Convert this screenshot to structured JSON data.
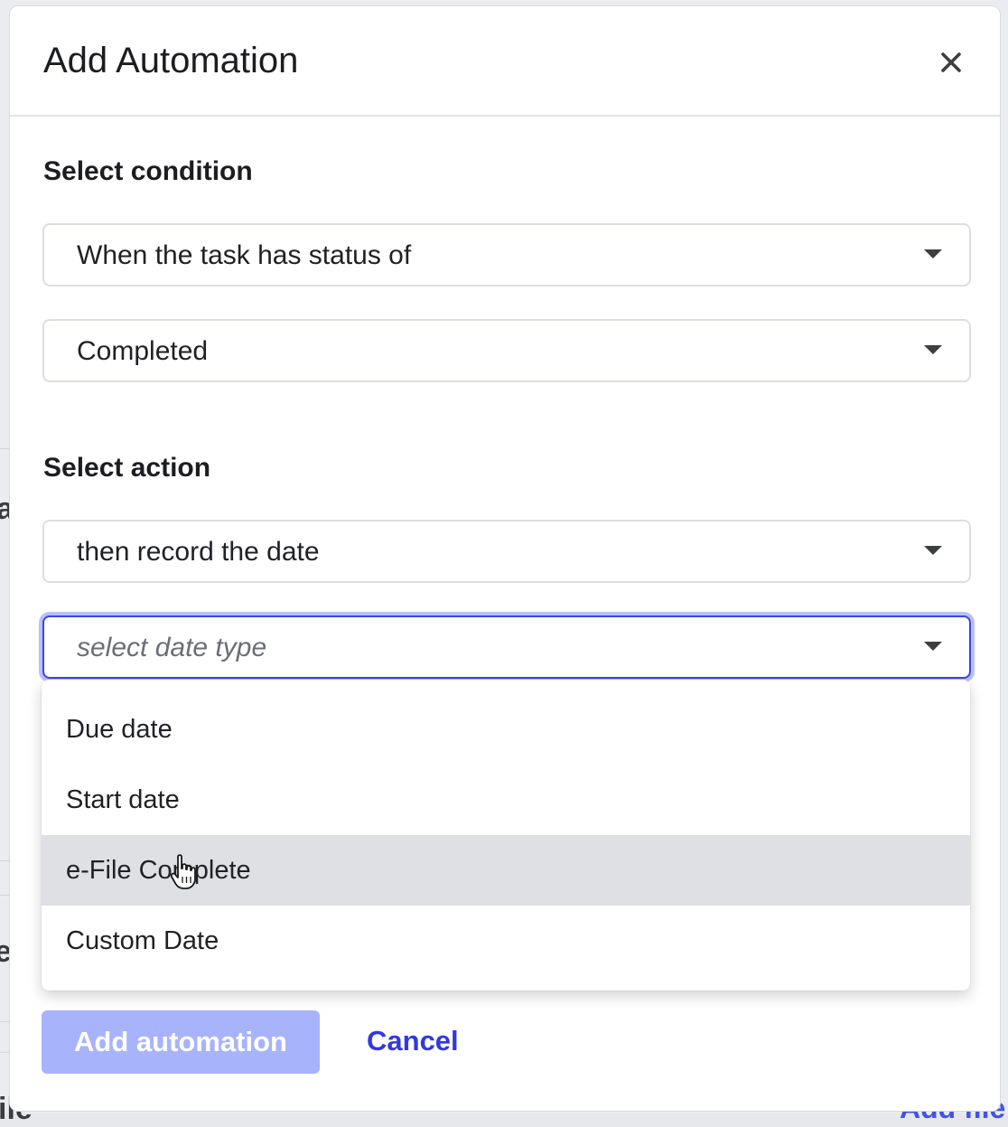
{
  "modal": {
    "title": "Add Automation",
    "close_icon": "close-icon"
  },
  "condition": {
    "label": "Select condition",
    "trigger_value": "When the task has status of",
    "status_value": "Completed"
  },
  "action": {
    "label": "Select action",
    "action_value": "then record the date",
    "date_type_placeholder": "select date type"
  },
  "date_type_options": [
    {
      "label": "Due date",
      "hovered": false
    },
    {
      "label": "Start date",
      "hovered": false
    },
    {
      "label": "e-File Complete",
      "hovered": true
    },
    {
      "label": "Custom Date",
      "hovered": false
    }
  ],
  "footer": {
    "add_label": "Add automation",
    "cancel_label": "Cancel"
  },
  "background": {
    "left_fragments": [
      "a",
      "e",
      "ile"
    ],
    "right_link_fragment": "Add file"
  },
  "colors": {
    "accent": "#3b45e8",
    "primary_disabled": "#a7b3fb",
    "link": "#3038e0",
    "hover": "#dfe0e3"
  }
}
